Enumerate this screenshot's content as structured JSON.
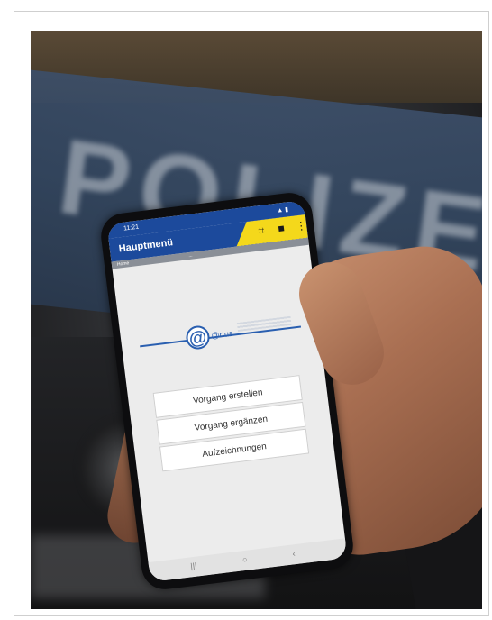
{
  "phone_screen": {
    "status_time": "11:21",
    "status_icons": "▲ ▮",
    "app_title": "Hauptmenü",
    "subbar_left": "Home",
    "subbar_center": "...",
    "logo_text": "@rtus",
    "menu_items": [
      {
        "label": "Vorgang erstellen"
      },
      {
        "label": "Vorgang ergänzen"
      },
      {
        "label": "Aufzeichnungen"
      }
    ],
    "appbar_icons": [
      "scan-icon",
      "folder-icon",
      "more-vert-icon"
    ],
    "nav_icons": [
      "recent-apps-icon",
      "home-icon",
      "back-icon"
    ]
  },
  "background": {
    "vehicle_lettering": "POLIZEI"
  },
  "colors": {
    "app_blue": "#1c4a9c",
    "app_yellow": "#f4d81b",
    "screen_background": "#ececec"
  }
}
